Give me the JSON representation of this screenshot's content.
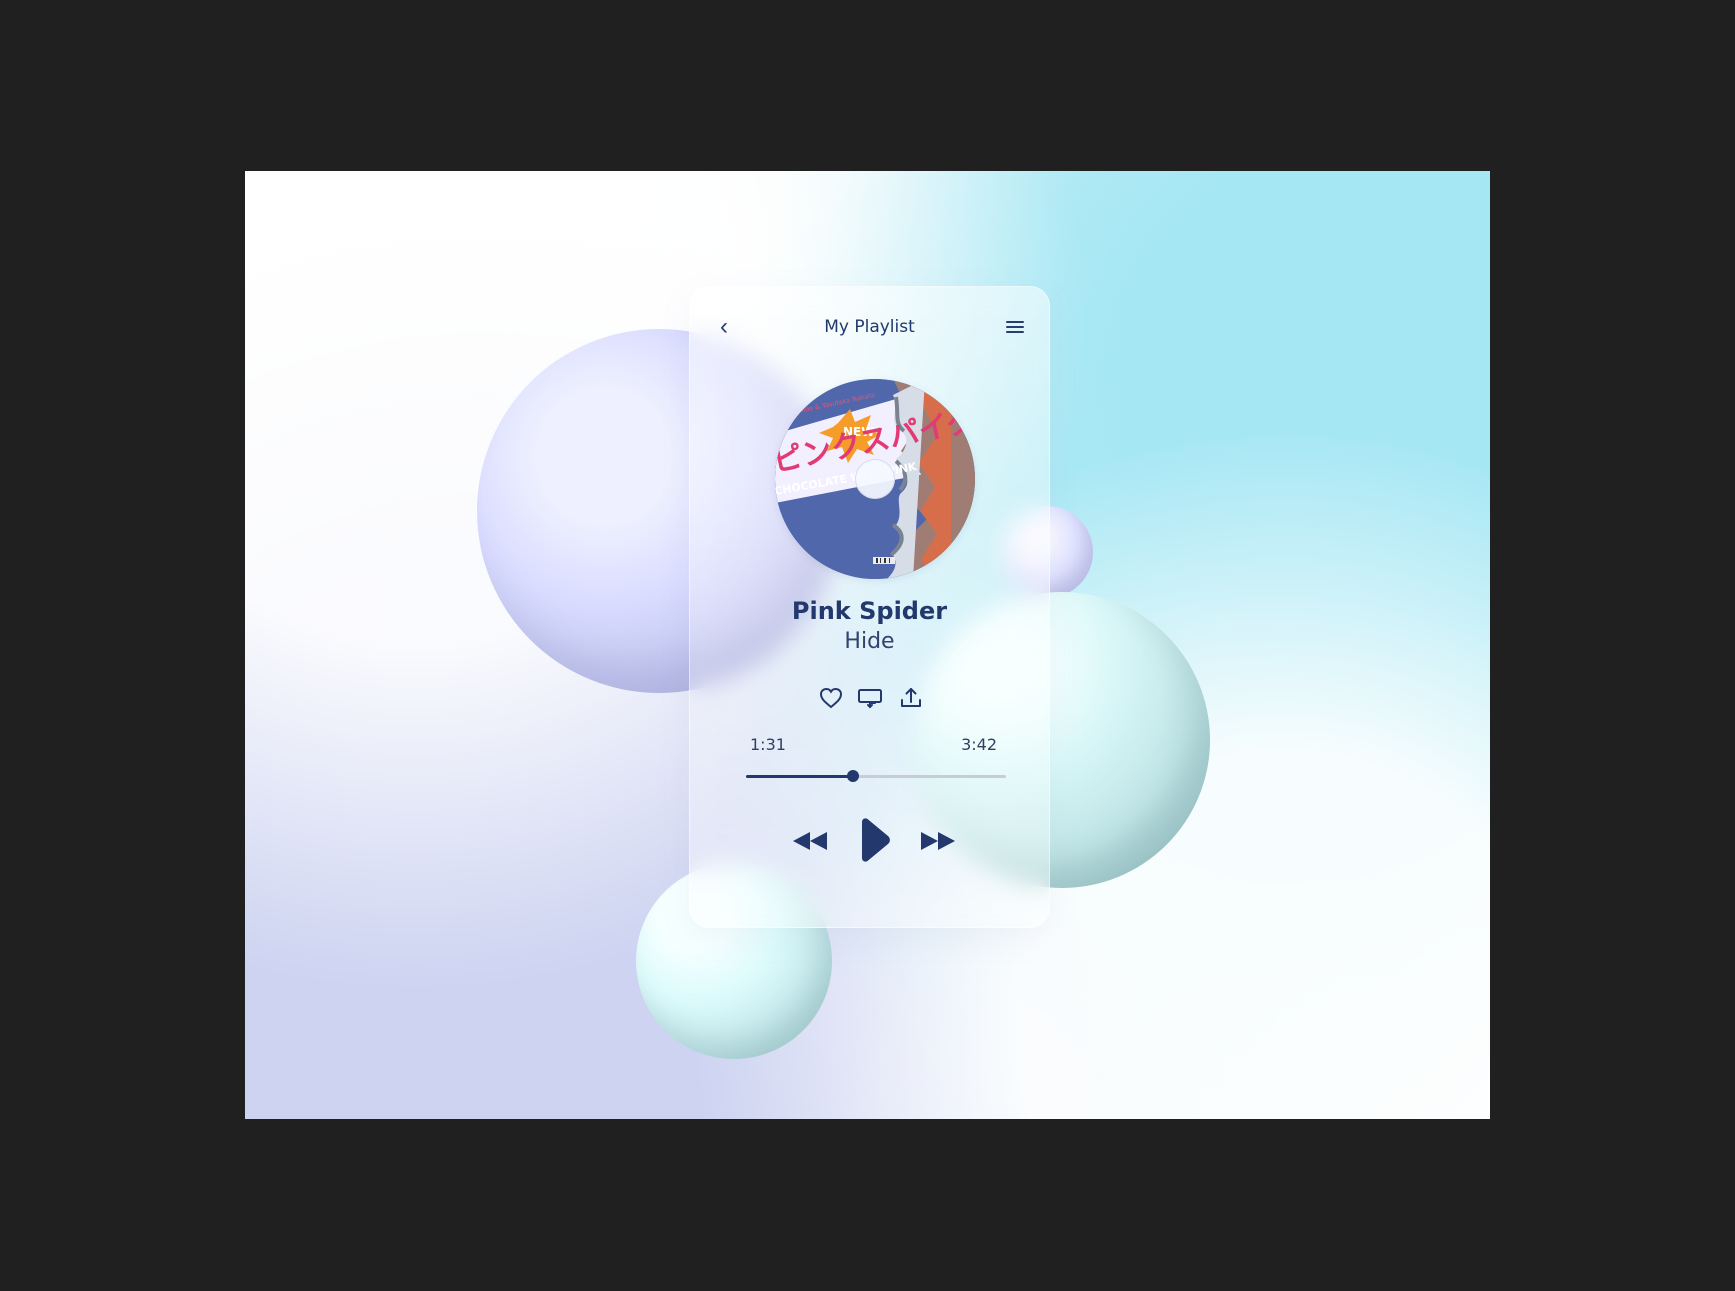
{
  "header": {
    "title": "My Playlist"
  },
  "track": {
    "title": "Pink Spider",
    "artist": "Hide",
    "current_time": "1:31",
    "total_time": "3:42",
    "progress_fraction": 0.41
  },
  "art": {
    "text_small": "Hide & Yasutaka Nakata",
    "text_new": "NEW",
    "text_katakana": "ピンクスパイダー",
    "text_band": "CHOCOLATE WITH PINK"
  },
  "icons": {
    "back": "chevron-left-icon",
    "menu": "hamburger-icon",
    "like": "heart-icon",
    "repeat": "repeat-icon",
    "share": "share-icon",
    "rewind": "rewind-icon",
    "play": "play-icon",
    "forward": "fast-forward-icon"
  },
  "colors": {
    "accent": "#23386c",
    "track": "#c7ccd6"
  }
}
